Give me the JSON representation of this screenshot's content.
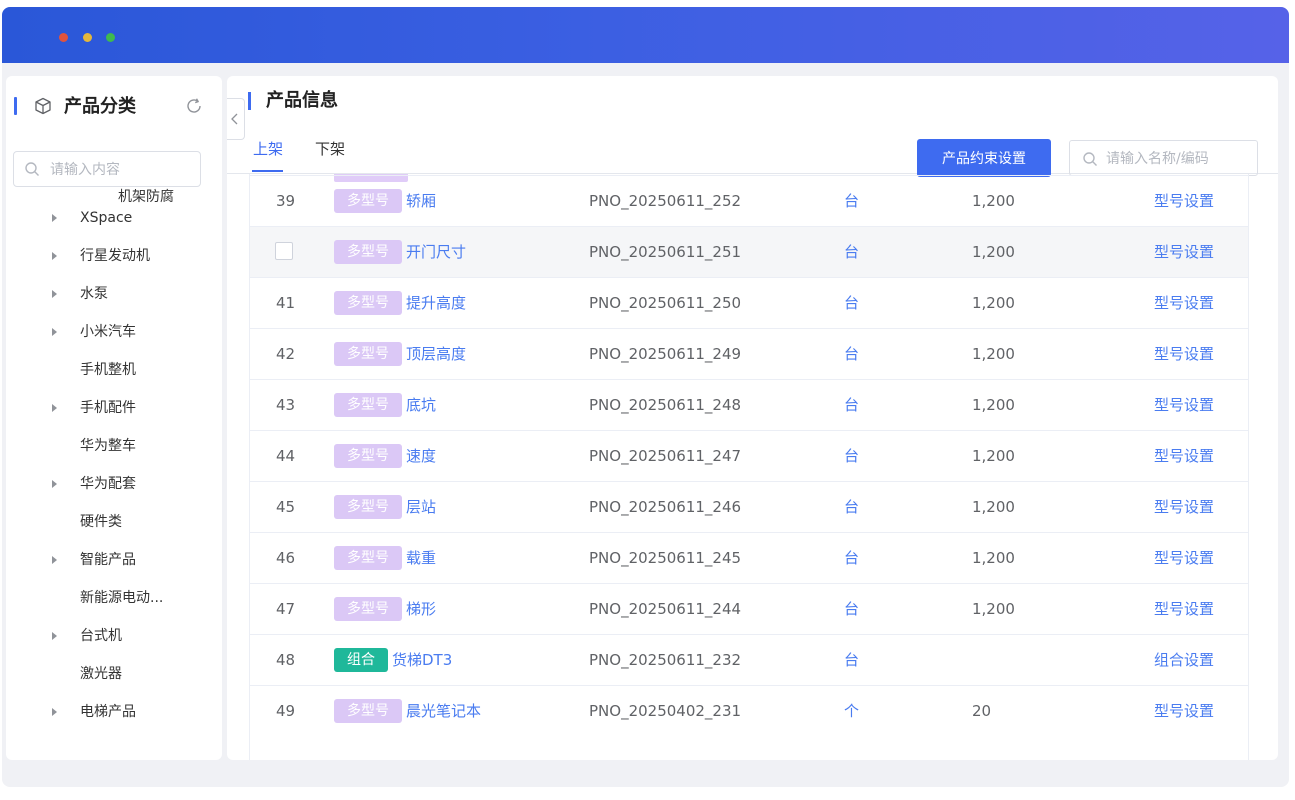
{
  "sidebar": {
    "title": "产品分类",
    "search_placeholder": "请输入内容",
    "items": [
      {
        "label": "机架防腐",
        "arrow": false
      },
      {
        "label": "XSpace",
        "arrow": true
      },
      {
        "label": "行星发动机",
        "arrow": true
      },
      {
        "label": "水泵",
        "arrow": true
      },
      {
        "label": "小米汽车",
        "arrow": true
      },
      {
        "label": "手机整机",
        "arrow": false
      },
      {
        "label": "手机配件",
        "arrow": true
      },
      {
        "label": "华为整车",
        "arrow": false
      },
      {
        "label": "华为配套",
        "arrow": true
      },
      {
        "label": "硬件类",
        "arrow": false
      },
      {
        "label": "智能产品",
        "arrow": true
      },
      {
        "label": "新能源电动...",
        "arrow": false
      },
      {
        "label": "台式机",
        "arrow": true
      },
      {
        "label": "激光器",
        "arrow": false
      },
      {
        "label": "电梯产品",
        "arrow": true
      }
    ]
  },
  "main": {
    "title": "产品信息",
    "tabs": [
      {
        "label": "上架",
        "active": true
      },
      {
        "label": "下架",
        "active": false
      }
    ],
    "constraint_button": "产品约束设置",
    "search_placeholder": "请输入名称/编码",
    "rows": [
      {
        "idx": "39",
        "tag": "多型号",
        "tag_type": "multi",
        "name": "轿厢",
        "pno": "PNO_20250611_252",
        "unit": "台",
        "qty": "1,200",
        "action": "型号设置",
        "hover": false
      },
      {
        "idx": "",
        "tag": "多型号",
        "tag_type": "multi",
        "name": "开门尺寸",
        "pno": "PNO_20250611_251",
        "unit": "台",
        "qty": "1,200",
        "action": "型号设置",
        "hover": true
      },
      {
        "idx": "41",
        "tag": "多型号",
        "tag_type": "multi",
        "name": "提升高度",
        "pno": "PNO_20250611_250",
        "unit": "台",
        "qty": "1,200",
        "action": "型号设置",
        "hover": false
      },
      {
        "idx": "42",
        "tag": "多型号",
        "tag_type": "multi",
        "name": "顶层高度",
        "pno": "PNO_20250611_249",
        "unit": "台",
        "qty": "1,200",
        "action": "型号设置",
        "hover": false
      },
      {
        "idx": "43",
        "tag": "多型号",
        "tag_type": "multi",
        "name": "底坑",
        "pno": "PNO_20250611_248",
        "unit": "台",
        "qty": "1,200",
        "action": "型号设置",
        "hover": false
      },
      {
        "idx": "44",
        "tag": "多型号",
        "tag_type": "multi",
        "name": "速度",
        "pno": "PNO_20250611_247",
        "unit": "台",
        "qty": "1,200",
        "action": "型号设置",
        "hover": false
      },
      {
        "idx": "45",
        "tag": "多型号",
        "tag_type": "multi",
        "name": "层站",
        "pno": "PNO_20250611_246",
        "unit": "台",
        "qty": "1,200",
        "action": "型号设置",
        "hover": false
      },
      {
        "idx": "46",
        "tag": "多型号",
        "tag_type": "multi",
        "name": "载重",
        "pno": "PNO_20250611_245",
        "unit": "台",
        "qty": "1,200",
        "action": "型号设置",
        "hover": false
      },
      {
        "idx": "47",
        "tag": "多型号",
        "tag_type": "multi",
        "name": "梯形",
        "pno": "PNO_20250611_244",
        "unit": "台",
        "qty": "1,200",
        "action": "型号设置",
        "hover": false
      },
      {
        "idx": "48",
        "tag": "组合",
        "tag_type": "combo",
        "name": "货梯DT3",
        "pno": "PNO_20250611_232",
        "unit": "台",
        "qty": "",
        "action": "组合设置",
        "hover": false
      },
      {
        "idx": "49",
        "tag": "多型号",
        "tag_type": "multi",
        "name": "晨光笔记本",
        "pno": "PNO_20250402_231",
        "unit": "个",
        "qty": "20",
        "action": "型号设置",
        "hover": false
      }
    ]
  },
  "colors": {
    "accent": "#3e6bf0",
    "link": "#4a7cf0",
    "tag_multi": "#dbc8f6",
    "tag_combo": "#1fb89a"
  }
}
